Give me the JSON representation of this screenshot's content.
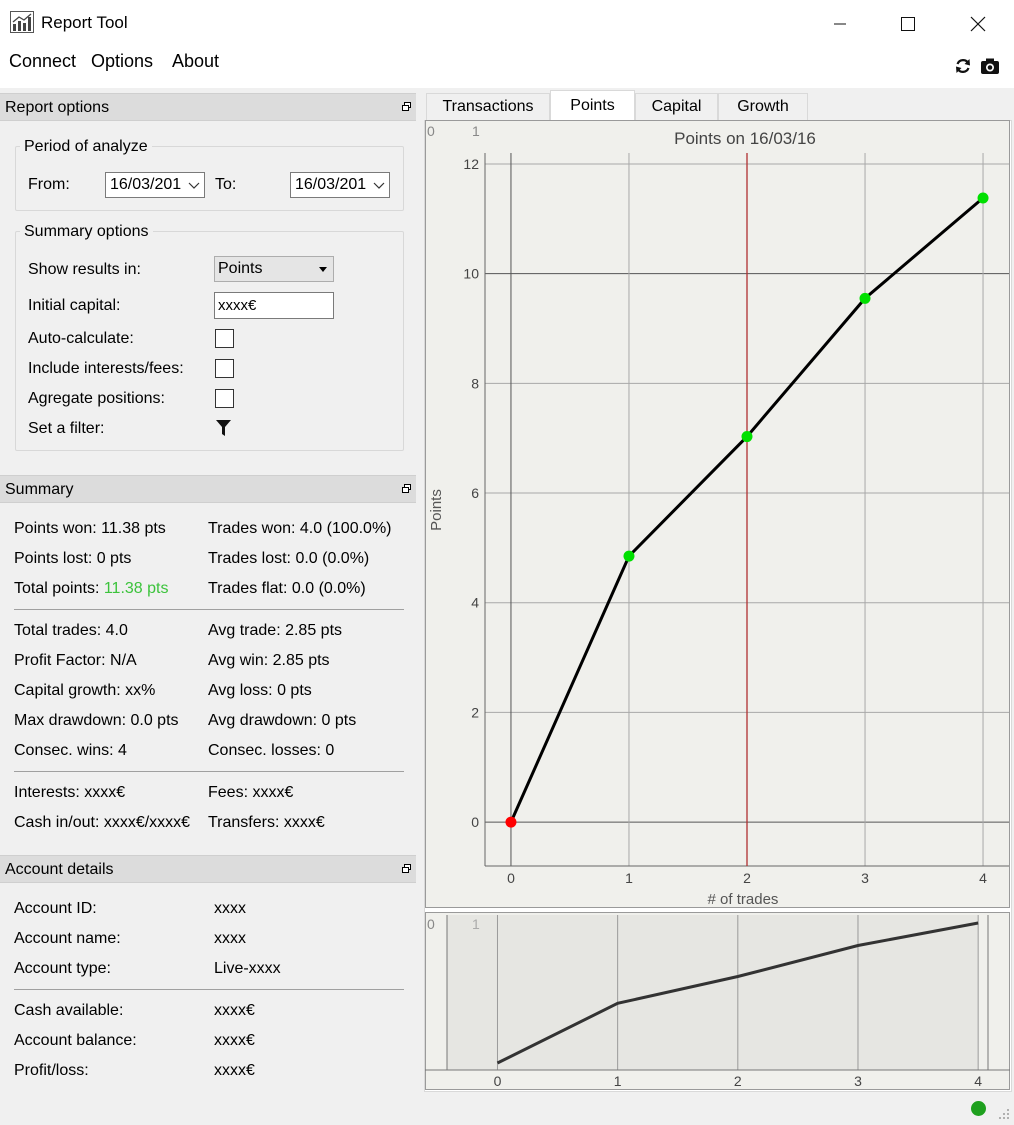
{
  "window": {
    "title": "Report Tool",
    "minimize_label": "—",
    "maximize_label": "☐",
    "close_label": "✕"
  },
  "menu": {
    "connect": "Connect",
    "options": "Options",
    "about": "About"
  },
  "toolbar": {
    "icons": [
      "refresh-icon",
      "camera-icon"
    ]
  },
  "report_options": {
    "header": "Report options",
    "period": {
      "title": "Period of analyze",
      "from_label": "From:",
      "from_value": "16/03/201",
      "to_label": "To:",
      "to_value": "16/03/201"
    },
    "summary_options": {
      "title": "Summary options",
      "show_results_label": "Show results in:",
      "show_results_value": "Points",
      "initial_capital_label": "Initial capital:",
      "initial_capital_value": "xxxx€",
      "auto_calculate_label": "Auto-calculate:",
      "auto_calculate_checked": false,
      "include_interests_label": "Include interests/fees:",
      "include_interests_checked": false,
      "aggregate_label": "Agregate positions:",
      "aggregate_checked": false,
      "filter_label": "Set a filter:"
    }
  },
  "summary": {
    "header": "Summary",
    "points_won": "Points won: 11.38 pts",
    "trades_won": "Trades won: 4.0 (100.0%)",
    "points_lost": "Points lost: 0 pts",
    "trades_lost": "Trades lost: 0.0 (0.0%)",
    "total_points_label": "Total points: ",
    "total_points_value": "11.38 pts",
    "trades_flat": "Trades flat: 0.0 (0.0%)",
    "total_trades": "Total trades: 4.0",
    "avg_trade": "Avg trade: 2.85 pts",
    "profit_factor": "Profit Factor: N/A",
    "avg_win": "Avg win: 2.85 pts",
    "capital_growth": "Capital growth: xx%",
    "avg_loss": "Avg loss: 0 pts",
    "max_drawdown": "Max drawdown: 0.0 pts",
    "avg_drawdown": "Avg drawdown: 0 pts",
    "consec_wins": "Consec. wins: 4",
    "consec_losses": "Consec. losses: 0",
    "interests": "Interests: xxxx€",
    "fees": "Fees: xxxx€",
    "cash_inout": "Cash in/out: xxxx€/xxxx€",
    "transfers": "Transfers: xxxx€"
  },
  "account": {
    "header": "Account details",
    "id_label": "Account ID:",
    "id_value": "xxxx",
    "name_label": "Account name:",
    "name_value": "xxxx",
    "type_label": "Account type:",
    "type_value": "Live-xxxx",
    "cash_label": "Cash available:",
    "cash_value": "xxxx€",
    "balance_label": "Account balance:",
    "balance_value": "xxxx€",
    "pl_label": "Profit/loss:",
    "pl_value": "xxxx€"
  },
  "tabs": [
    "Transactions",
    "Points",
    "Capital",
    "Growth"
  ],
  "active_tab": "Points",
  "colors": {
    "point_normal": "#00e000",
    "point_first": "#ff0000",
    "cursor_line": "#b03030",
    "total_points_text": "#3cc33c",
    "status_ok": "#1ea01e"
  },
  "chart_data": [
    {
      "type": "line",
      "title": "Points on 16/03/16",
      "xlabel": "# of trades",
      "ylabel": "Points",
      "x": [
        0,
        1,
        2,
        3,
        4
      ],
      "y": [
        0,
        4.85,
        7.03,
        9.55,
        11.38
      ],
      "xlim": [
        -0.22,
        4.22
      ],
      "ylim": [
        -0.8,
        12.2
      ],
      "xticks": [
        "0",
        "1",
        "2",
        "3",
        "4"
      ],
      "yticks": [
        "0",
        "2",
        "4",
        "6",
        "8",
        "10",
        "12"
      ],
      "cursor_x": 2,
      "corner_labels": [
        "0",
        "1"
      ],
      "grid": true
    },
    {
      "type": "line",
      "x": [
        0,
        1,
        2,
        3,
        4
      ],
      "y": [
        0,
        4.85,
        7.03,
        9.55,
        11.38
      ],
      "xticks": [
        "0",
        "1",
        "2",
        "3",
        "4"
      ],
      "corner_labels": [
        "0",
        "1"
      ]
    }
  ]
}
